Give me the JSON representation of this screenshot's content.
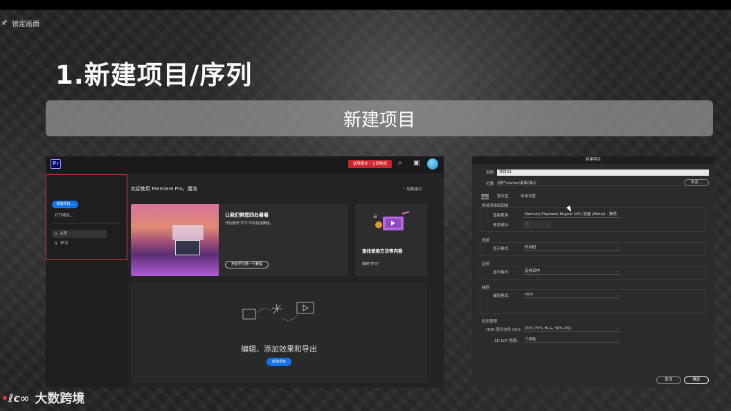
{
  "overlay": {
    "lock_label": "锁定画面",
    "brand": "大数跨境",
    "brand_mark": "ℓc∞"
  },
  "slide": {
    "section_title": "1.新建项目/序列",
    "banner": "新建项目"
  },
  "premiere": {
    "logo": "Pr",
    "trial_button": "试用版本｜立即购买",
    "sidebar": {
      "new_project": "新建项目...",
      "open_project": "打开项目...",
      "nav": [
        {
          "label": "主页",
          "icon": "home-icon"
        },
        {
          "label": "学习",
          "icon": "lightbulb-icon"
        }
      ]
    },
    "welcome": "欢迎使用 Premiere Pro，魔浩",
    "hide_tips": "隐藏建议",
    "hero_card": {
      "title": "让我们带您四处看看",
      "desc": "开始使用\"学习\"中的快速教程。",
      "button": "开始学习第一个教程"
    },
    "find_card": {
      "title": "查找使用方法等内容",
      "link": "转到\"学习\""
    },
    "main_card": {
      "caption": "编辑、添加效果和导出",
      "button": "新建项目"
    }
  },
  "new_project": {
    "title": "新建项目",
    "name_label": "名称:",
    "name_value": "项目01",
    "location_label": "位置:",
    "location_value": "/用户/carles/桌面/演示",
    "browse": "浏览...",
    "tabs": [
      "常规",
      "暂存盘",
      "收录设置"
    ],
    "renderer_section": "视频渲染和回放",
    "renderer_label": "渲染程序:",
    "renderer_value": "Mercury Playback Engine GPU 加速 (Metal) - 推荐",
    "preview_cache_label": "预览缓存:",
    "preview_cache_value": "无",
    "video_section": "视频",
    "video_display_label": "显示格式:",
    "video_display_value": "时间码",
    "audio_section": "音频",
    "audio_display_label": "显示格式:",
    "audio_display_value": "音频采样",
    "capture_section": "捕捉",
    "capture_label": "捕捉格式:",
    "capture_value": "HDV",
    "color_section": "色彩管理",
    "hdr_label": "HDR 图形白色 (Nit):",
    "hdr_value": "203 (75% HLG, 58% PQ)",
    "lut_label": "3D LUT 插值:",
    "lut_value": "三线性",
    "cancel": "取消",
    "ok": "确定"
  }
}
